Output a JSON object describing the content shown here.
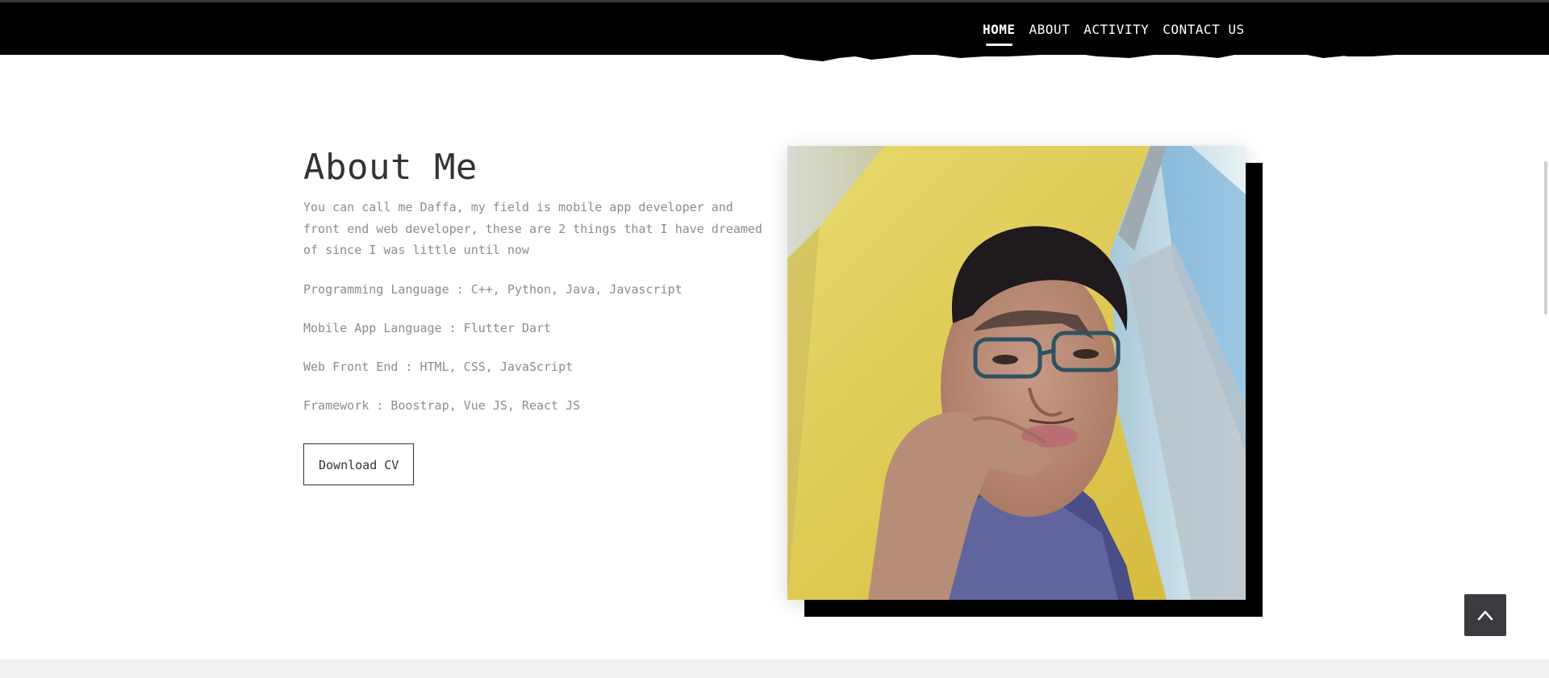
{
  "nav": {
    "items": [
      {
        "label": "HOME",
        "active": true
      },
      {
        "label": "ABOUT",
        "active": false
      },
      {
        "label": "ACTIVITY",
        "active": false
      },
      {
        "label": "CONTACT US",
        "active": false
      }
    ]
  },
  "about": {
    "title": "About Me",
    "intro": "You can call me Daffa, my field is mobile app developer and front end web developer, these are 2 things that I have dreamed of since I was little until now",
    "skills": [
      "Programming Language : C++, Python, Java, Javascript",
      "Mobile App Language : Flutter Dart",
      "Web Front End : HTML, CSS, JavaScript",
      "Framework : Boostrap, Vue JS, React JS"
    ],
    "download_label": "Download CV"
  },
  "icons": {
    "back_to_top": "chevron-up-icon",
    "photo": "profile-photo"
  },
  "colors": {
    "header_bg": "#000000",
    "title": "#333333",
    "body_text": "#8c8c8c",
    "button_border": "#333333",
    "to_top_bg": "#3a3b3f",
    "photo_shadow": "#000000"
  }
}
